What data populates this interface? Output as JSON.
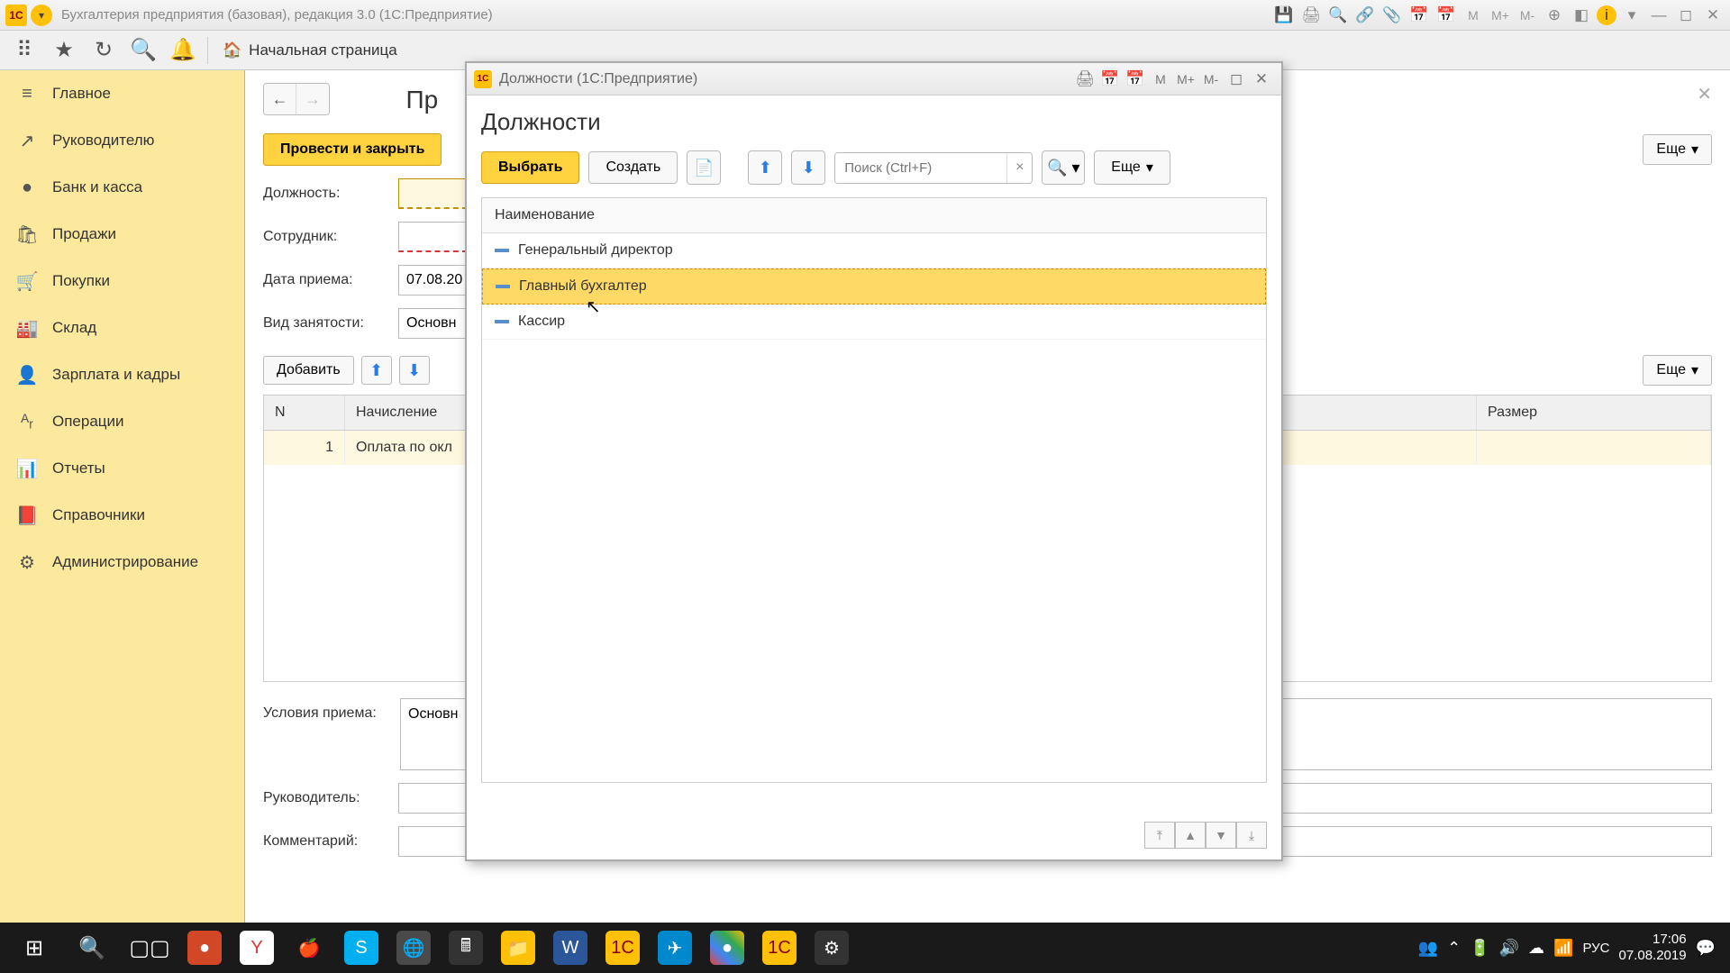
{
  "titlebar": {
    "title": "Бухгалтерия предприятия (базовая), редакция 3.0  (1С:Предприятие)",
    "m": "M",
    "mp": "M+",
    "mm": "M-"
  },
  "toptoolbar": {
    "home": "Начальная страница"
  },
  "sidebar": {
    "items": [
      {
        "label": "Главное",
        "icon": "≡"
      },
      {
        "label": "Руководителю",
        "icon": "↗"
      },
      {
        "label": "Банк и касса",
        "icon": "●"
      },
      {
        "label": "Продажи",
        "icon": "🛍"
      },
      {
        "label": "Покупки",
        "icon": "🛒"
      },
      {
        "label": "Склад",
        "icon": "🏭"
      },
      {
        "label": "Зарплата и кадры",
        "icon": "👤"
      },
      {
        "label": "Операции",
        "icon": "ᴬᵣ"
      },
      {
        "label": "Отчеты",
        "icon": "📊"
      },
      {
        "label": "Справочники",
        "icon": "📕"
      },
      {
        "label": "Администрирование",
        "icon": "⚙"
      }
    ]
  },
  "main": {
    "title": "Пр",
    "submit": "Провести и закрыть",
    "more": "Еще",
    "labels": {
      "position": "Должность:",
      "employee": "Сотрудник:",
      "hire_date": "Дата приема:",
      "employment": "Вид занятости:",
      "conditions": "Условия приема:",
      "manager": "Руководитель:",
      "comment": "Комментарий:"
    },
    "values": {
      "hire_date": "07.08.20",
      "employment": "Основн",
      "conditions": "Основн"
    },
    "add": "Добавить",
    "grid": {
      "cols": {
        "n": "N",
        "accrual": "Начисление",
        "size": "Размер"
      },
      "row": {
        "n": "1",
        "accrual": "Оплата по окл"
      }
    }
  },
  "modal": {
    "titlebar": "Должности  (1С:Предприятие)",
    "m": "M",
    "mp": "M+",
    "mm": "M-",
    "heading": "Должности",
    "select": "Выбрать",
    "create": "Создать",
    "more": "Еще",
    "search_placeholder": "Поиск (Ctrl+F)",
    "list_header": "Наименование",
    "items": [
      "Генеральный директор",
      "Главный бухгалтер",
      "Кассир"
    ],
    "selected_index": 1
  },
  "taskbar": {
    "lang": "РУС",
    "time": "17:06",
    "date": "07.08.2019"
  }
}
